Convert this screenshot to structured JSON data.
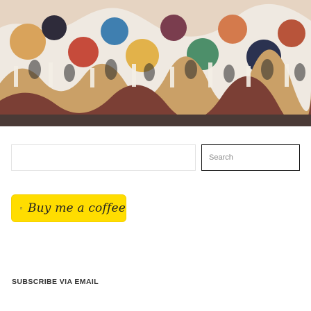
{
  "banner": {
    "image": "colorful-illustration-banner"
  },
  "search": {
    "input_value": "",
    "input_placeholder": "",
    "button_label": "Search"
  },
  "donate": {
    "button_text": "Buy me a coffee",
    "icon": "coffee-cup-icon",
    "background_color": "#ffdd00"
  },
  "subscribe": {
    "heading": "SUBSCRIBE VIA EMAIL"
  }
}
